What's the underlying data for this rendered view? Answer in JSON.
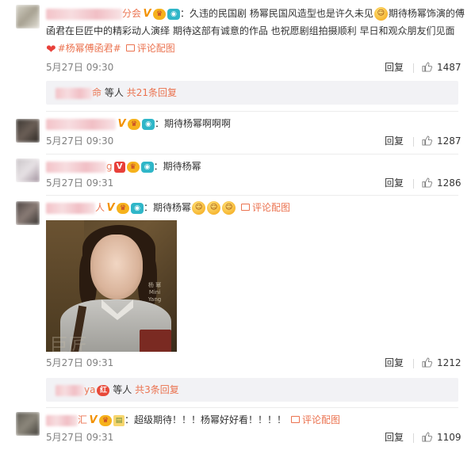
{
  "comments": [
    {
      "name_tail": "分会",
      "text_line1": "：久违的民国剧 杨幂民国风造型也是许久未见",
      "text_line1b": "期待杨幂饰演的傅",
      "text_line2": "函君在巨匠中的精彩动人演绎 期待这部有诚意的作品 也祝愿剧组拍摄顺利 早日和观众朋友们见面",
      "hashtag": "#杨幂傅函君#",
      "pic_link": "评论配图",
      "time": "5月27日 09:30",
      "reply": "回复",
      "likes": "1487",
      "subreply": {
        "name_tail": "命",
        "text": "等人",
        "count": "共21条回复"
      }
    },
    {
      "text": "：期待杨幂啊啊啊",
      "time": "5月27日 09:30",
      "reply": "回复",
      "likes": "1287"
    },
    {
      "name_tail": "g",
      "text": "：期待杨幂",
      "time": "5月27日 09:31",
      "reply": "回复",
      "likes": "1286"
    },
    {
      "name_tail": "人",
      "text": "：期待杨幂",
      "pic_link": "评论配图",
      "poster_title": "巨匠",
      "poster_caption": "杨 幂 Mini Yang",
      "time": "5月27日 09:31",
      "reply": "回复",
      "likes": "1212",
      "subreply": {
        "name_tail": "ya",
        "text": "等人",
        "count": "共3条回复"
      }
    },
    {
      "name_tail": "汇",
      "text": "：超级期待！！！杨幂好好看！！！！",
      "pic_link": "评论配图",
      "time": "5月27日 09:31",
      "reply": "回复",
      "likes": "1109"
    }
  ],
  "icons": {
    "verified": "V",
    "crown": "crown-badge-icon",
    "camera": "camera-badge-icon",
    "heart": "❤",
    "emoji": "emoji-icon",
    "like": "thumbs-up-icon",
    "picture": "picture-icon"
  },
  "colors": {
    "link": "#eb7350",
    "time": "#808080",
    "panel": "#f2f2f5"
  }
}
